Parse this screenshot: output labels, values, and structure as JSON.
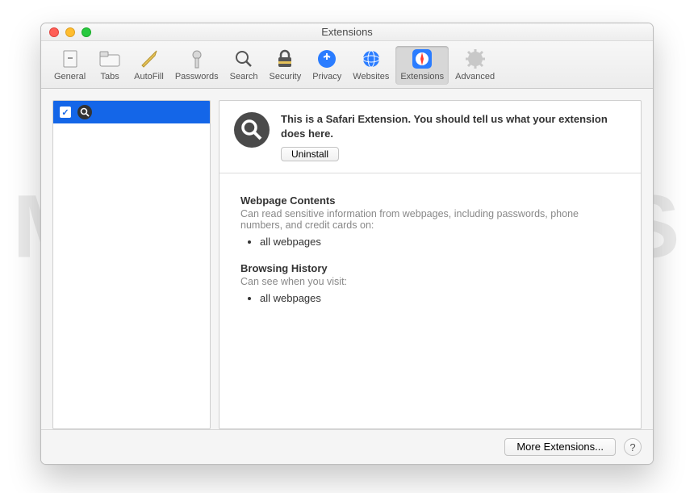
{
  "watermark": "MALWARETIPS",
  "window": {
    "title": "Extensions"
  },
  "toolbar": {
    "items": [
      {
        "label": "General"
      },
      {
        "label": "Tabs"
      },
      {
        "label": "AutoFill"
      },
      {
        "label": "Passwords"
      },
      {
        "label": "Search"
      },
      {
        "label": "Security"
      },
      {
        "label": "Privacy"
      },
      {
        "label": "Websites"
      },
      {
        "label": "Extensions"
      },
      {
        "label": "Advanced"
      }
    ]
  },
  "sidebar": {
    "items": [
      {
        "checked": true
      }
    ]
  },
  "detail": {
    "description": "This is a Safari Extension. You should tell us what your extension does here.",
    "uninstall_label": "Uninstall",
    "sections": [
      {
        "heading": "Webpage Contents",
        "subtext": "Can read sensitive information from webpages, including passwords, phone numbers, and credit cards on:",
        "bullets": [
          "all webpages"
        ]
      },
      {
        "heading": "Browsing History",
        "subtext": "Can see when you visit:",
        "bullets": [
          "all webpages"
        ]
      }
    ]
  },
  "footer": {
    "more_label": "More Extensions...",
    "help_label": "?"
  }
}
